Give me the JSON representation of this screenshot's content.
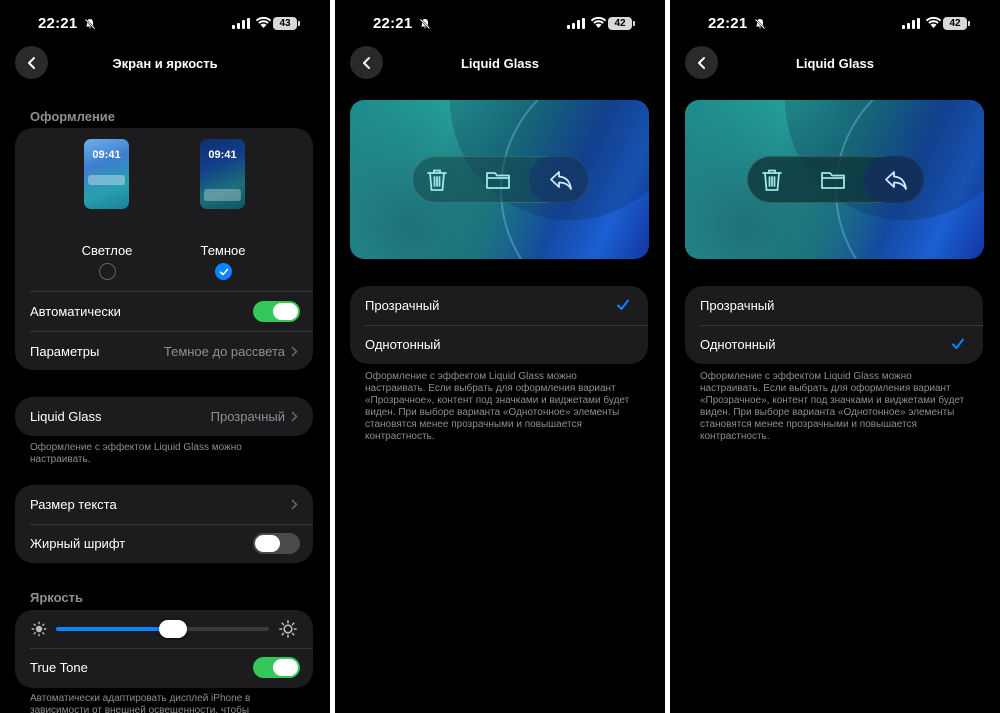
{
  "screen1": {
    "status": {
      "time": "22:21",
      "battery": "43"
    },
    "title": "Экран и яркость",
    "appearance": {
      "header": "Оформление",
      "preview_time": "09:41",
      "light_label": "Светлое",
      "dark_label": "Темное",
      "selected": "dark",
      "auto_label": "Автоматически",
      "auto_on": true,
      "params_label": "Параметры",
      "params_value": "Темное до рассвета"
    },
    "liquid_glass": {
      "label": "Liquid Glass",
      "value": "Прозрачный",
      "footnote": "Оформление с эффектом Liquid Glass можно настраивать."
    },
    "text": {
      "size_label": "Размер текста",
      "bold_label": "Жирный шрифт",
      "bold_on": false
    },
    "brightness": {
      "header": "Яркость",
      "level": 0.55,
      "true_tone_label": "True Tone",
      "true_tone_on": true,
      "footnote": "Автоматически адаптировать дисплей iPhone в зависимости от внешней освещенности, чтобы цвета"
    }
  },
  "screen2": {
    "status": {
      "time": "22:21",
      "battery": "42"
    },
    "title": "Liquid Glass",
    "option_clear": "Прозрачный",
    "option_tinted": "Однотонный",
    "selected": "clear",
    "footnote": "Оформление с эффектом Liquid Glass можно настраивать. Если выбрать для оформления вариант «Прозрачное», контент под значками и виджетами будет виден. При выборе варианта «Однотонное» элементы становятся менее прозрачными и повышается контрастность."
  },
  "screen3": {
    "status": {
      "time": "22:21",
      "battery": "42"
    },
    "title": "Liquid Glass",
    "option_clear": "Прозрачный",
    "option_tinted": "Однотонный",
    "selected": "tinted",
    "footnote": "Оформление с эффектом Liquid Glass можно настраивать. Если выбрать для оформления вариант «Прозрачное», контент под значками и виджетами будет виден. При выборе варианта «Однотонное» элементы становятся менее прозрачными и повышается контрастность."
  },
  "colors": {
    "accent": "#0a84ff",
    "toggle_on": "#34c759",
    "group_bg": "#1c1c1e",
    "secondary_text": "#8e8e93"
  },
  "icons": [
    "bell-slash-icon",
    "cellular-icon",
    "wifi-icon",
    "battery-icon",
    "back-chevron-icon",
    "chevron-right-icon",
    "checkmark-icon",
    "sun-min-icon",
    "sun-max-icon",
    "trash-icon",
    "folder-icon",
    "reply-icon"
  ]
}
